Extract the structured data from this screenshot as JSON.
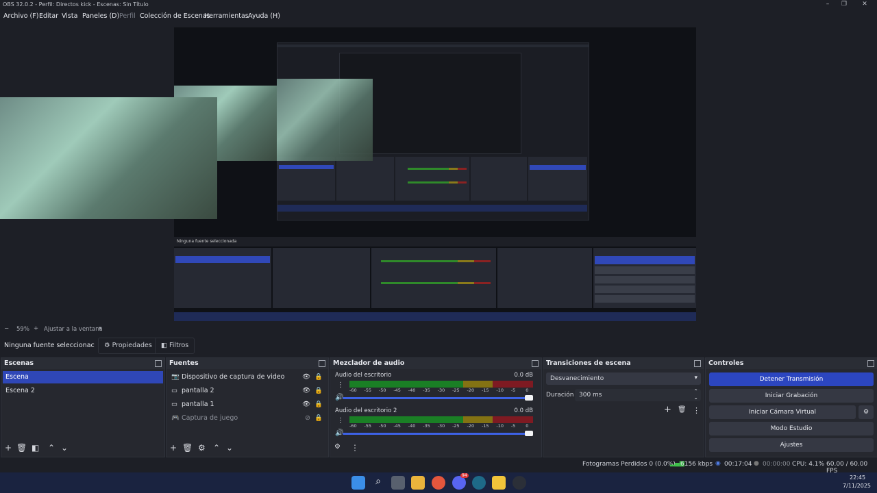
{
  "window": {
    "title": "OBS 32.0.2 - Perfil: Directos kick - Escenas: Sin Título"
  },
  "menu": [
    "Archivo (F)",
    "Editar",
    "Vista",
    "Paneles (D)",
    "Perfil",
    "Colección de Escenas",
    "Herramientas",
    "Ayuda (H)"
  ],
  "zoom": {
    "minus": "−",
    "value": "59%",
    "plus": "+",
    "fit": "Ajustar a la ventana"
  },
  "source_toolbar": {
    "none_selected": "Ninguna fuente seleccionac",
    "properties": "Propiedades",
    "filters": "Filtros"
  },
  "scenes": {
    "title": "Escenas",
    "items": [
      "Escena",
      "Escena 2"
    ],
    "selected": 0
  },
  "sources": {
    "title": "Fuentes",
    "items": [
      {
        "name": "Dispositivo de captura de video",
        "icon": "camera-icon",
        "visible": true
      },
      {
        "name": "pantalla 2",
        "icon": "monitor-icon",
        "visible": true
      },
      {
        "name": "pantalla 1",
        "icon": "monitor-icon",
        "visible": true
      },
      {
        "name": "Captura de juego",
        "icon": "gamepad-icon",
        "visible": false
      }
    ]
  },
  "mixer": {
    "title": "Mezclador de audio",
    "tracks": [
      {
        "name": "Audio del escritorio",
        "db": "0.0 dB"
      },
      {
        "name": "Audio del escritorio 2",
        "db": "0.0 dB"
      }
    ],
    "scale": [
      "-60",
      "-55",
      "-50",
      "-45",
      "-40",
      "-35",
      "-30",
      "-25",
      "-20",
      "-15",
      "-10",
      "-5",
      "0"
    ]
  },
  "transitions": {
    "title": "Transiciones de escena",
    "selected": "Desvanecimiento",
    "duration_label": "Duración",
    "duration": "300 ms"
  },
  "controls": {
    "title": "Controles",
    "buttons": [
      "Detener Transmisión",
      "Iniciar Grabación",
      "Iniciar Cámara Virtual",
      "Modo Estudio",
      "Ajustes"
    ]
  },
  "status": {
    "dropped": "Fotogramas Perdidos 0 (0.0%)",
    "bitrate": "6156 kbps",
    "stream_time": "00:17:04",
    "rec_time": "00:00:00",
    "cpu": "CPU: 4.1%",
    "fps": "60.00 / 60.00 FPS"
  },
  "taskbar": {
    "time": "22:45",
    "date": "7/11/2025",
    "badge": "94"
  },
  "colors": {
    "accent": "#2f47b7",
    "background": "#1d1f26",
    "dock": "#26282f"
  }
}
